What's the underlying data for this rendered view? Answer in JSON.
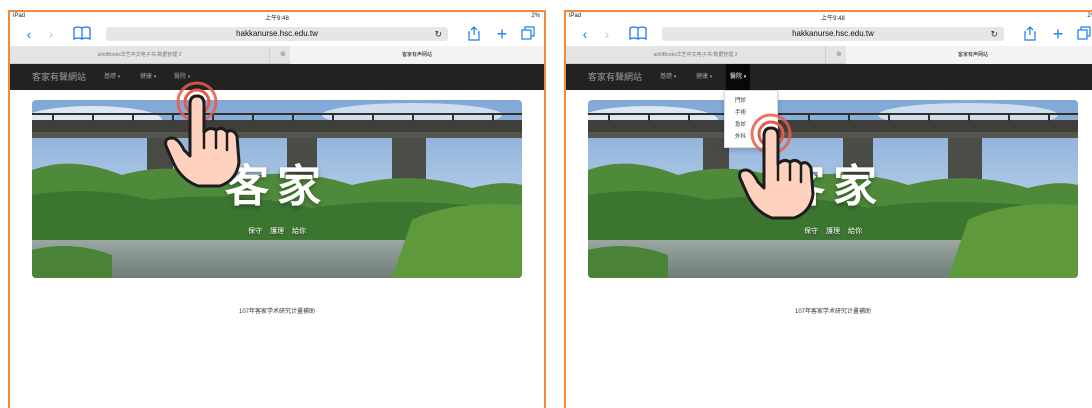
{
  "status": {
    "device": "iPad",
    "time": "上午9:48",
    "battery": "2%"
  },
  "browser": {
    "url": "hakkanurse.hsc.edu.tw",
    "tabs": [
      {
        "title": "airitiBooks华艺中文电子书-数据管理 2"
      },
      {
        "title": "客家有声网站"
      }
    ]
  },
  "site": {
    "brand": "客家有聲網站",
    "nav": [
      {
        "label": "基礎"
      },
      {
        "label": "健康"
      },
      {
        "label": "醫院"
      }
    ],
    "dropdown": [
      "門診",
      "手術",
      "急診",
      "外科"
    ],
    "hero": {
      "title": "客家",
      "links": [
        "保守",
        "護理",
        "給你"
      ]
    },
    "footer": "107年客家学术研究计畫補助"
  },
  "colors": {
    "panel_border": "#f08a3c",
    "navbar": "#222222",
    "ios_blue": "#1a7cf0",
    "tap_ring": "#ea5a4a",
    "hand_fill": "#ffd2bf"
  },
  "icons": [
    "back-icon",
    "forward-icon",
    "bookmarks-icon",
    "reload-icon",
    "share-icon",
    "add-tab-icon",
    "tabs-icon",
    "tap-hand-icon"
  ]
}
